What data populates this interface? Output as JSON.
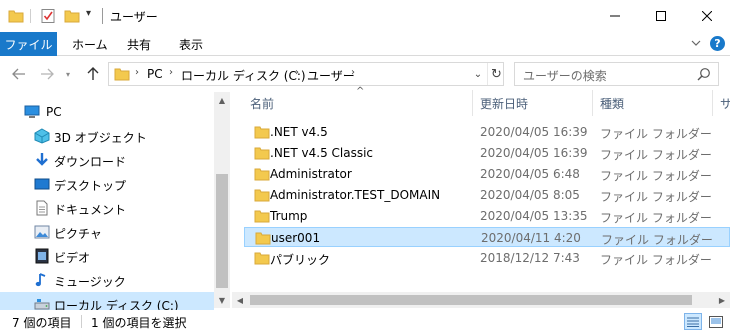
{
  "window": {
    "title": "ユーザー",
    "colors": {
      "accent": "#1979ca",
      "folder": "#f3c94e",
      "selection": "#cce8ff"
    }
  },
  "ribbon": {
    "tabs": [
      {
        "label": "ファイル"
      },
      {
        "label": "ホーム"
      },
      {
        "label": "共有"
      },
      {
        "label": "表示"
      }
    ],
    "help_label": "?"
  },
  "address": {
    "crumbs": [
      "PC",
      "ローカル ディスク (C:)",
      "ユーザー"
    ]
  },
  "search": {
    "placeholder": "ユーザーの検索"
  },
  "navpane": {
    "items": [
      {
        "label": "PC",
        "icon": "pc-icon"
      },
      {
        "label": "3D オブジェクト",
        "icon": "3d-objects-icon"
      },
      {
        "label": "ダウンロード",
        "icon": "download-icon"
      },
      {
        "label": "デスクトップ",
        "icon": "desktop-icon"
      },
      {
        "label": "ドキュメント",
        "icon": "documents-icon"
      },
      {
        "label": "ピクチャ",
        "icon": "pictures-icon"
      },
      {
        "label": "ビデオ",
        "icon": "videos-icon"
      },
      {
        "label": "ミュージック",
        "icon": "music-icon"
      },
      {
        "label": "ローカル ディスク (C:)",
        "icon": "local-disk-icon"
      }
    ]
  },
  "filelist": {
    "columns": {
      "name": "名前",
      "date": "更新日時",
      "type": "種類",
      "size": "サ"
    },
    "rows": [
      {
        "name": ".NET v4.5",
        "date": "2020/04/05 16:39",
        "type": "ファイル フォルダー"
      },
      {
        "name": ".NET v4.5 Classic",
        "date": "2020/04/05 16:39",
        "type": "ファイル フォルダー"
      },
      {
        "name": "Administrator",
        "date": "2020/04/05 6:48",
        "type": "ファイル フォルダー"
      },
      {
        "name": "Administrator.TEST_DOMAIN",
        "date": "2020/04/05 8:05",
        "type": "ファイル フォルダー"
      },
      {
        "name": "Trump",
        "date": "2020/04/05 13:35",
        "type": "ファイル フォルダー"
      },
      {
        "name": "user001",
        "date": "2020/04/11 4:20",
        "type": "ファイル フォルダー"
      },
      {
        "name": "パブリック",
        "date": "2018/12/12 7:43",
        "type": "ファイル フォルダー"
      }
    ]
  },
  "status": {
    "item_count": "7 個の項目",
    "selected": "1 個の項目を選択"
  }
}
